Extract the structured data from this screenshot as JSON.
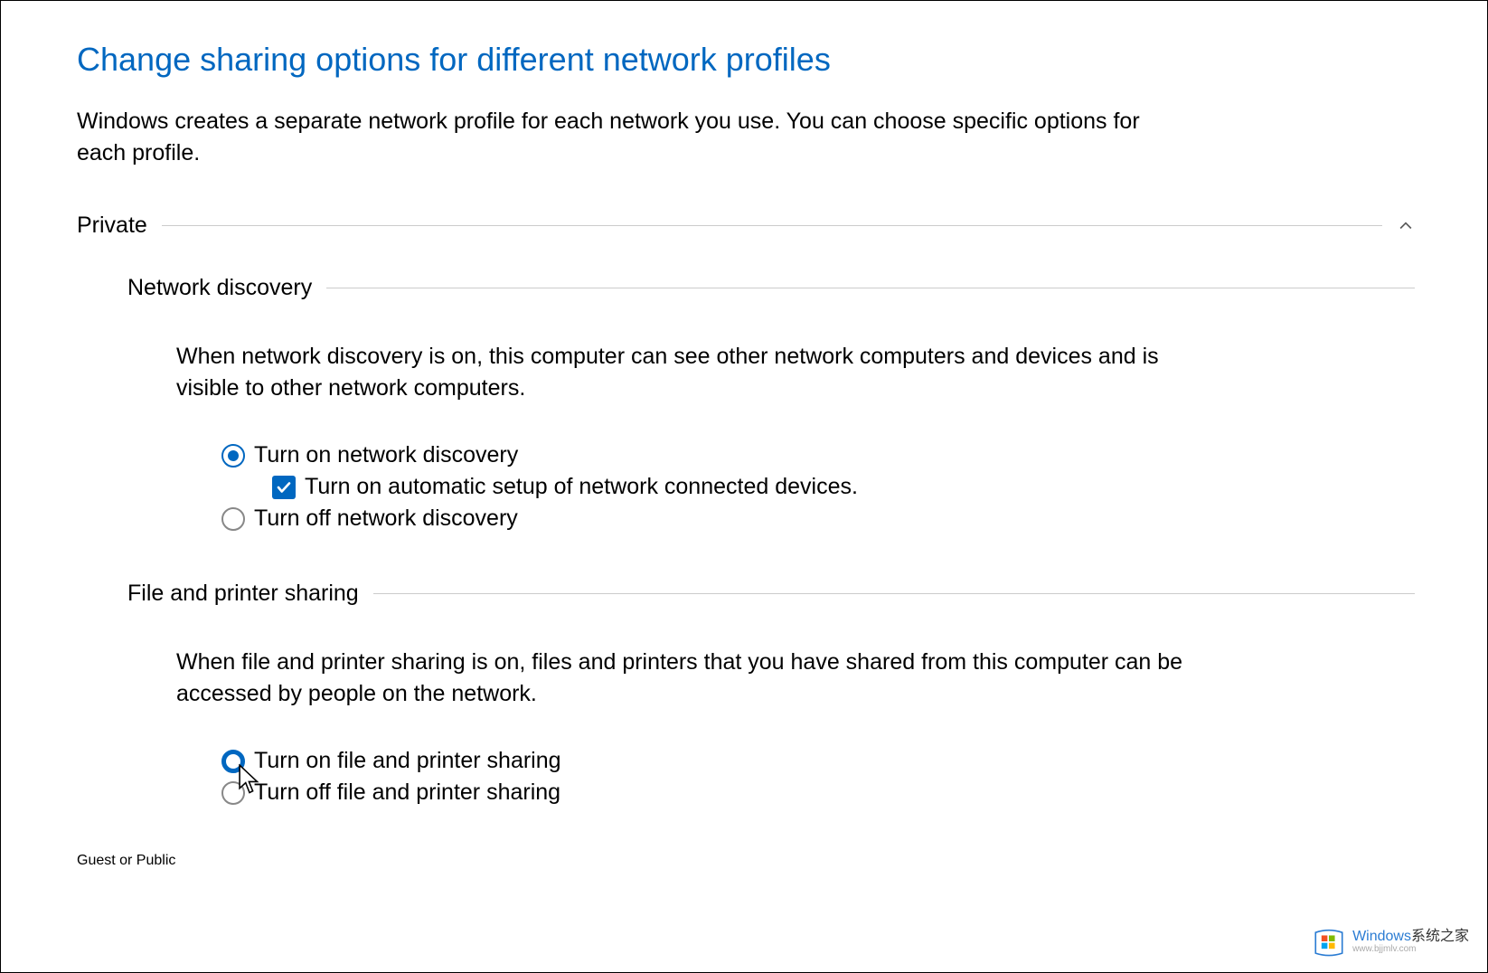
{
  "page": {
    "title": "Change sharing options for different network profiles",
    "description": "Windows creates a separate network profile for each network you use. You can choose specific options for each profile."
  },
  "profiles": {
    "private": {
      "label": "Private",
      "expanded": true,
      "sections": {
        "network_discovery": {
          "title": "Network discovery",
          "description": "When network discovery is on, this computer can see other network computers and devices and is visible to other network computers.",
          "options": {
            "on_label": "Turn on network discovery",
            "auto_setup_label": "Turn on automatic setup of network connected devices.",
            "off_label": "Turn off network discovery",
            "selected": "on",
            "auto_setup_checked": true
          }
        },
        "file_printer_sharing": {
          "title": "File and printer sharing",
          "description": "When file and printer sharing is on, files and printers that you have shared from this computer can be accessed by people on the network.",
          "options": {
            "on_label": "Turn on file and printer sharing",
            "off_label": "Turn off file and printer sharing",
            "selected": "on"
          }
        }
      }
    },
    "guest_public": {
      "label": "Guest or Public",
      "expanded": false
    }
  },
  "watermark": {
    "brand": "Windows",
    "cn": "系统之家",
    "url": "www.bjjmlv.com"
  }
}
